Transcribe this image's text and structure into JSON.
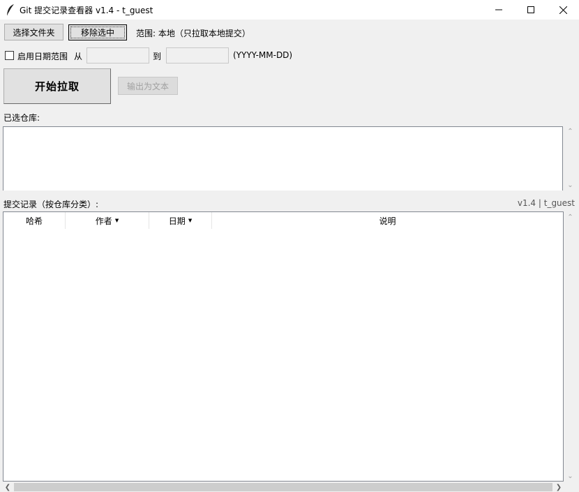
{
  "window": {
    "title": "Git 提交记录查看器 v1.4 - t_guest"
  },
  "toolbar": {
    "choose_folder": "选择文件夹",
    "remove_selected": "移除选中",
    "scope": "范围: 本地（只拉取本地提交）"
  },
  "date_range": {
    "enable_label": "启用日期范围",
    "checked": false,
    "from_label": "从",
    "from_value": "",
    "to_label": "到",
    "to_value": "",
    "format_hint": "(YYYY-MM-DD)"
  },
  "actions": {
    "start": "开始拉取",
    "export": "输出为文本"
  },
  "repos": {
    "label": "已选仓库:",
    "items": []
  },
  "commits": {
    "label": "提交记录（按仓库分类）:",
    "version_info": "v1.4 | t_guest",
    "columns": [
      "哈希",
      "作者",
      "日期",
      "说明"
    ],
    "rows": []
  },
  "icons": [
    "feather-icon",
    "minimize-icon",
    "maximize-icon",
    "close-icon",
    "caret-down-icon",
    "scroll-up-icon",
    "scroll-down-icon",
    "scroll-left-icon",
    "scroll-right-icon"
  ]
}
